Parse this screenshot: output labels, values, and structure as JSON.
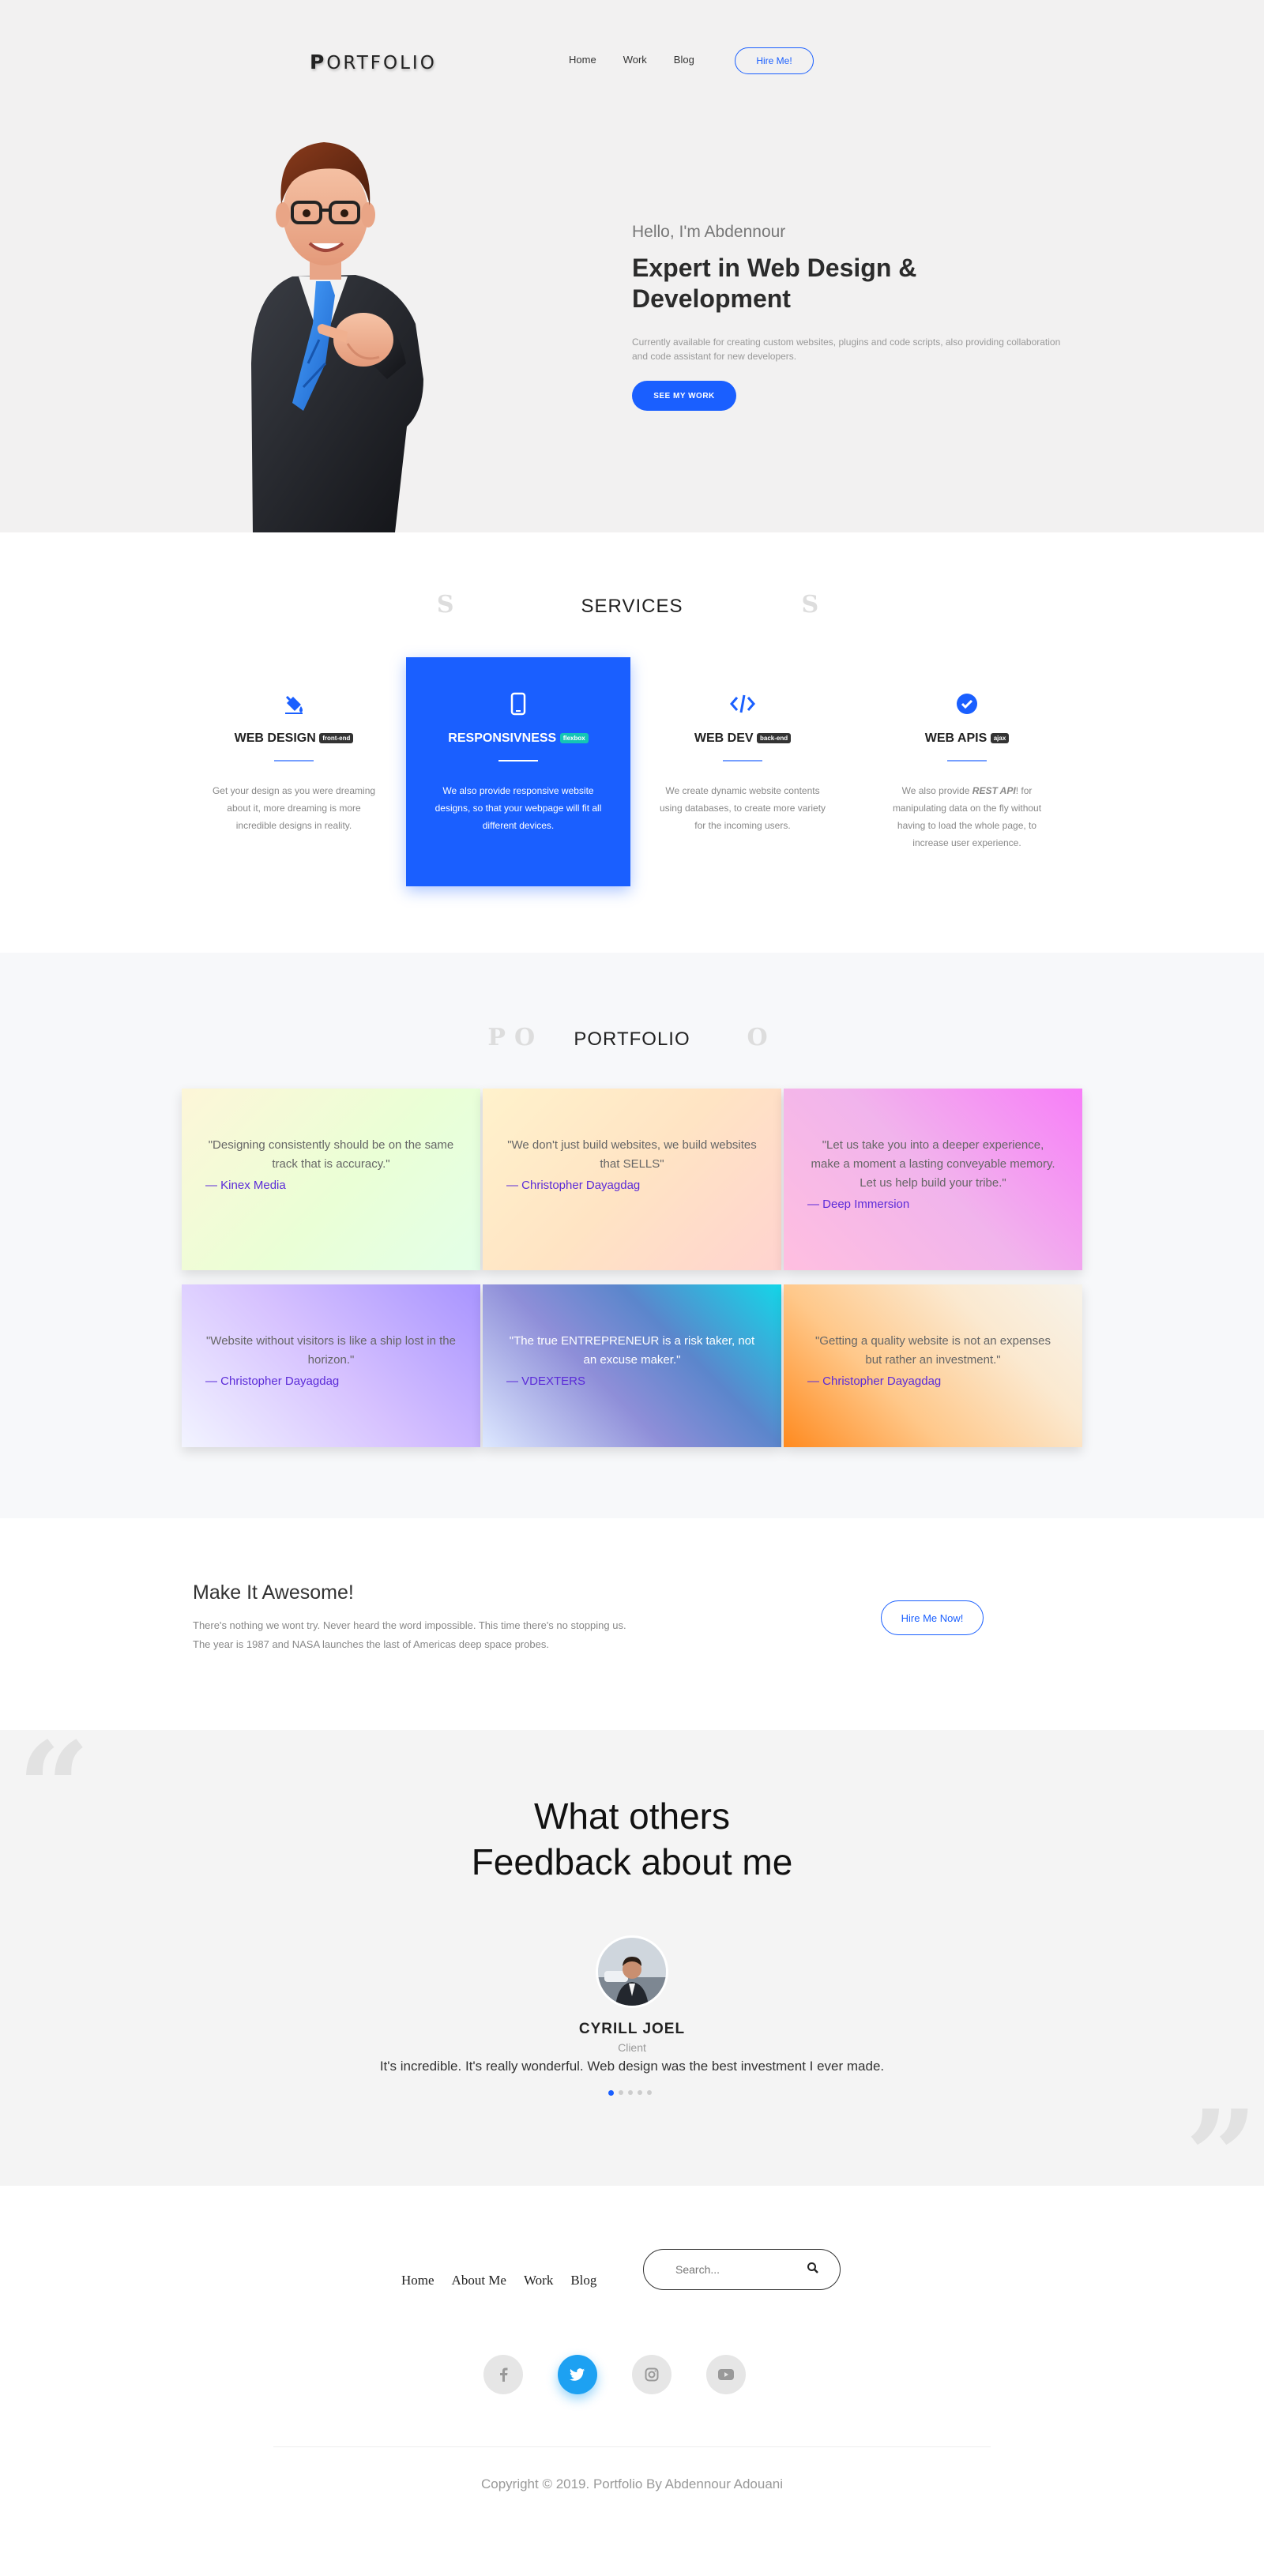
{
  "header": {
    "logo": "PORTFOLIO",
    "nav": [
      "Home",
      "Work",
      "Blog"
    ],
    "hire_label": "Hire Me!"
  },
  "hero": {
    "hello": "Hello, I'm Abdennour",
    "title": "Expert in Web Design & Development",
    "description": "Currently available for creating custom websites, plugins and code scripts, also providing collaboration and code assistant for new developers.",
    "cta_label": "SEE MY WORK"
  },
  "services": {
    "title": "SERVICES",
    "shadow_title": "S                    S",
    "items": [
      {
        "icon": "paint-bucket-icon",
        "title": "WEB DESIGN",
        "badge": "front-end",
        "text": "Get your design as you were dreaming about it, more dreaming is more incredible designs in reality."
      },
      {
        "icon": "mobile-phone-icon",
        "title": "RESPONSIVNESS",
        "badge": "flexbox",
        "text": "We also provide responsive website designs, so that your webpage will fit all different devices."
      },
      {
        "icon": "code-icon",
        "title": "WEB DEV",
        "badge": "back-end",
        "text": "We create dynamic website contents using databases, to create more variety for the incoming users."
      },
      {
        "icon": "check-circle-icon",
        "title": "WEB APIS",
        "badge": "ajax",
        "text_pre": "We also provide ",
        "text_em": "REST API",
        "text_post": "! for manipulating data on the fly without having to load the whole page, to increase user experience."
      }
    ]
  },
  "portfolio": {
    "title": "PORTFOLIO",
    "shadow_title": "PO            O",
    "tiles": [
      {
        "quote": "\"Designing consistently should be on the same track that is accuracy.\"",
        "author": "— Kinex Media"
      },
      {
        "quote": "\"We don't just build websites, we build websites that SELLS\"",
        "author": "— Christopher Dayagdag"
      },
      {
        "quote": "\"Let us take you into a deeper experience, make a moment a lasting conveyable memory. Let us help build your tribe.\"",
        "author": "— Deep Immersion"
      },
      {
        "quote": "\"Website without visitors is like a ship lost in the horizon.\"",
        "author": "— Christopher Dayagdag"
      },
      {
        "quote": "\"The true ENTREPRENEUR is a risk taker, not an excuse maker.\"",
        "author": "— VDEXTERS"
      },
      {
        "quote": "\"Getting a quality website is not an expenses but rather an investment.\"",
        "author": "— Christopher Dayagdag"
      }
    ]
  },
  "cta": {
    "title": "Make It Awesome!",
    "line1": "There's nothing we wont try. Never heard the word impossible. This time there's no stopping us.",
    "line2": "The year is 1987 and NASA launches the last of Americas deep space probes.",
    "button": "Hire Me Now!"
  },
  "feedback": {
    "title_line1": "What others",
    "title_line2": "Feedback about me",
    "name": "CYRILL JOEL",
    "role": "Client",
    "text": "It's incredible. It's really wonderful. Web design was the best investment I ever made.",
    "slide_count": 5,
    "active_slide": 1
  },
  "footer": {
    "nav": [
      "Home",
      "About Me",
      "Work",
      "Blog"
    ],
    "search_placeholder": "Search...",
    "socials": [
      "facebook-icon",
      "twitter-icon",
      "instagram-icon",
      "youtube-icon"
    ],
    "active_social": "twitter-icon",
    "copyright": "Copyright © 2019. Portfolio By Abdennour Adouani"
  },
  "colors": {
    "accent": "#1a5fff",
    "hero_bg": "#f2f1f1",
    "twitter": "#1da1f2",
    "author": "#5b2bd8"
  }
}
